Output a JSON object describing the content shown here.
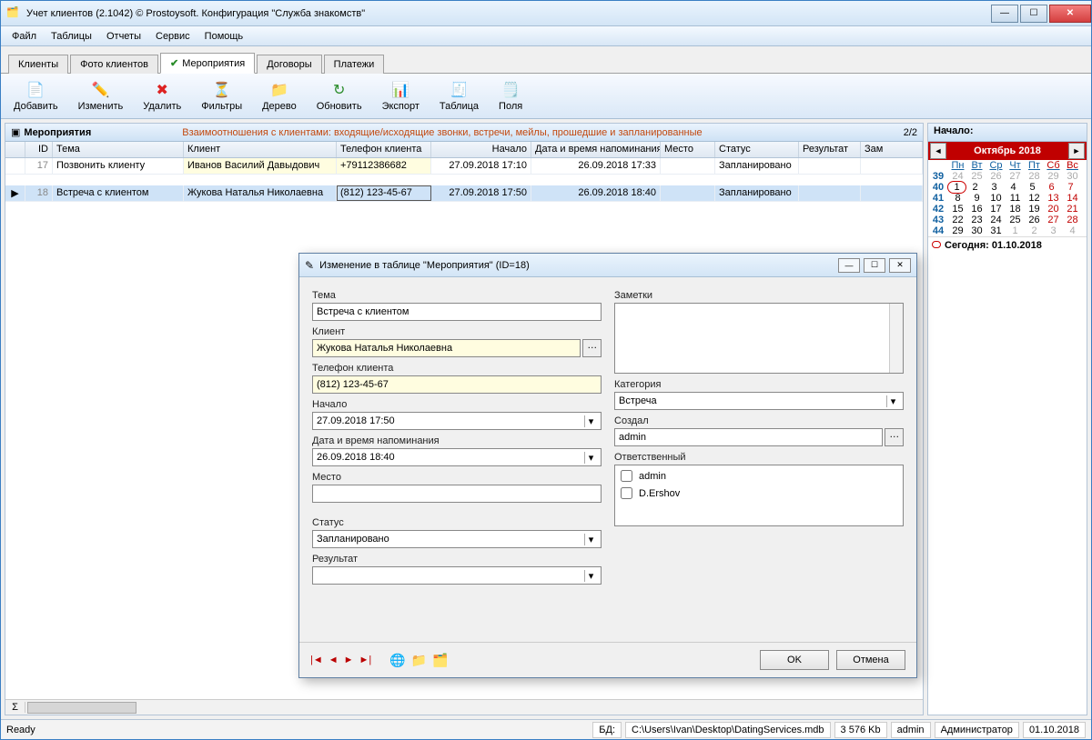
{
  "window": {
    "title": "Учет клиентов (2.1042) © Prostoysoft. Конфигурация \"Служба знакомств\""
  },
  "menu": {
    "items": [
      "Файл",
      "Таблицы",
      "Отчеты",
      "Сервис",
      "Помощь"
    ]
  },
  "tabs": {
    "items": [
      "Клиенты",
      "Фото клиентов",
      "Мероприятия",
      "Договоры",
      "Платежи"
    ],
    "active": 2
  },
  "toolbar": {
    "add": "Добавить",
    "edit": "Изменить",
    "delete": "Удалить",
    "filters": "Фильтры",
    "tree": "Дерево",
    "refresh": "Обновить",
    "export": "Экспорт",
    "table": "Таблица",
    "fields": "Поля"
  },
  "grid": {
    "title": "Мероприятия",
    "desc": "Взаимоотношения с клиентами: входящие/исходящие звонки, встречи, мейлы, прошедшие и запланированные",
    "count": "2/2",
    "cols": {
      "id": "ID",
      "tema": "Тема",
      "klient": "Клиент",
      "tel": "Телефон клиента",
      "nachalo": "Начало",
      "napom": "Дата и время напоминания",
      "mesto": "Место",
      "status": "Статус",
      "result": "Результат",
      "zam": "Зам"
    },
    "rows": [
      {
        "id": "17",
        "tema": "Позвонить клиенту",
        "klient": "Иванов Василий Давыдович",
        "tel": "+79112386682",
        "nachalo": "27.09.2018 17:10",
        "napom": "26.09.2018 17:33",
        "mesto": "",
        "status": "Запланировано",
        "result": ""
      },
      {
        "id": "18",
        "tema": "Встреча с клиентом",
        "klient": "Жукова Наталья Николаевна",
        "tel": "(812) 123-45-67",
        "nachalo": "27.09.2018 17:50",
        "napom": "26.09.2018 18:40",
        "mesto": "",
        "status": "Запланировано",
        "result": ""
      }
    ]
  },
  "calendar": {
    "panelTitle": "Начало:",
    "month": "Октябрь 2018",
    "dow": [
      "Пн",
      "Вт",
      "Ср",
      "Чт",
      "Пт",
      "Сб",
      "Вс"
    ],
    "weeks": [
      {
        "no": "39",
        "days": [
          "24",
          "25",
          "26",
          "27",
          "28",
          "29",
          "30"
        ],
        "dim": [
          0,
          1,
          2,
          3,
          4,
          5,
          6
        ]
      },
      {
        "no": "40",
        "days": [
          "1",
          "2",
          "3",
          "4",
          "5",
          "6",
          "7"
        ],
        "today": 0
      },
      {
        "no": "41",
        "days": [
          "8",
          "9",
          "10",
          "11",
          "12",
          "13",
          "14"
        ]
      },
      {
        "no": "42",
        "days": [
          "15",
          "16",
          "17",
          "18",
          "19",
          "20",
          "21"
        ]
      },
      {
        "no": "43",
        "days": [
          "22",
          "23",
          "24",
          "25",
          "26",
          "27",
          "28"
        ]
      },
      {
        "no": "44",
        "days": [
          "29",
          "30",
          "31",
          "1",
          "2",
          "3",
          "4"
        ],
        "dim": [
          3,
          4,
          5,
          6
        ]
      }
    ],
    "todayLabel": "Сегодня: 01.10.2018"
  },
  "modal": {
    "title": "Изменение в таблице \"Мероприятия\" (ID=18)",
    "labels": {
      "tema": "Тема",
      "klient": "Клиент",
      "tel": "Телефон клиента",
      "nachalo": "Начало",
      "napom": "Дата и время напоминания",
      "mesto": "Место",
      "status": "Статус",
      "result": "Результат",
      "notes": "Заметки",
      "category": "Категория",
      "creator": "Создал",
      "responsible": "Ответственный"
    },
    "values": {
      "tema": "Встреча с клиентом",
      "klient": "Жукова Наталья Николаевна",
      "tel": "(812) 123-45-67",
      "nachalo": "27.09.2018 17:50",
      "napom": "26.09.2018 18:40",
      "mesto": "",
      "status": "Запланировано",
      "result": "",
      "category": "Встреча",
      "creator": "admin"
    },
    "responsible": [
      "admin",
      "D.Ershov"
    ],
    "buttons": {
      "ok": "OK",
      "cancel": "Отмена"
    }
  },
  "status": {
    "ready": "Ready",
    "bdLabel": "БД:",
    "bdPath": "C:\\Users\\Ivan\\Desktop\\DatingServices.mdb",
    "size": "3 576 Kb",
    "user": "admin",
    "role": "Администратор",
    "date": "01.10.2018"
  }
}
